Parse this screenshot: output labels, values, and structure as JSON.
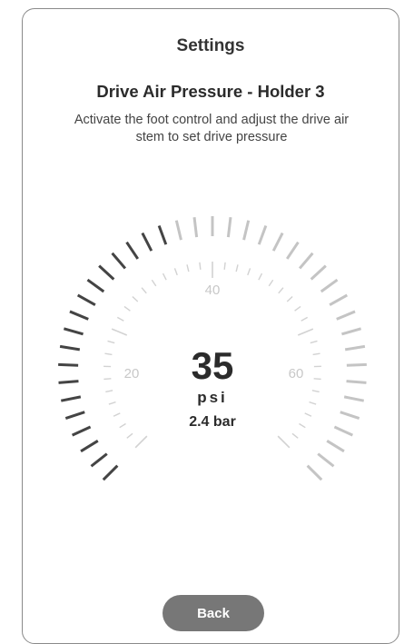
{
  "header": {
    "title": "Settings",
    "subtitle": "Drive Air Pressure - Holder 3",
    "instruction": "Activate the foot control and adjust the drive air stem to set drive pressure"
  },
  "gauge": {
    "value": "35",
    "unit": "psi",
    "secondary": "2.4 bar",
    "min": 0,
    "max": 80,
    "current": 35,
    "scale_labels": [
      "20",
      "40",
      "60"
    ],
    "colors": {
      "active": "#444444",
      "inactive": "#c4c4c4",
      "minor": "#d2d2d2"
    }
  },
  "footer": {
    "back_label": "Back"
  }
}
